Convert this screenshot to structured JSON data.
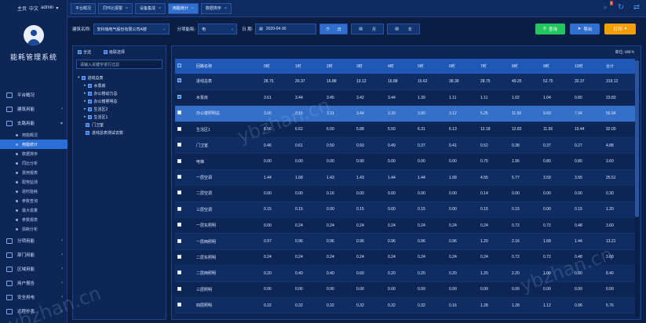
{
  "user": {
    "home": "主页",
    "lang": "中文",
    "name": "admin",
    "caret": "▾"
  },
  "system_title": "能耗管理系统",
  "menu": [
    {
      "label": "平台概况",
      "arrow": ""
    },
    {
      "label": "建筑用能",
      "arrow": "›"
    },
    {
      "label": "支路用能",
      "arrow": "▾"
    }
  ],
  "submenu": [
    "用能概况",
    "用能统计",
    "数据排序",
    "同比分析",
    "费用报表",
    "配电监测",
    "逐时能耗",
    "参数查询",
    "最大需量",
    "参数报表",
    "损耗分析"
  ],
  "menu2": [
    {
      "label": "分项用能",
      "arrow": "›"
    },
    {
      "label": "部门用能",
      "arrow": "›"
    },
    {
      "label": "区域用能",
      "arrow": "›"
    },
    {
      "label": "用户报告",
      "arrow": "›"
    },
    {
      "label": "安全用电",
      "arrow": "›"
    },
    {
      "label": "远程抄表",
      "arrow": "›"
    }
  ],
  "tabs": [
    {
      "label": "平台概况",
      "closable": false
    },
    {
      "label": "同环比报警",
      "closable": true
    },
    {
      "label": "设备集成",
      "closable": true
    },
    {
      "label": "用能统计",
      "closable": true
    },
    {
      "label": "数据排序",
      "closable": true
    }
  ],
  "header_badge": "1",
  "filters": {
    "building_label": "建筑名称:",
    "building_value": "安科瑞电气股份有限公司A楼",
    "energy_label": "分项能耗:",
    "energy_value": "电",
    "date_label": "日 期:",
    "date_value": "2020-04-30",
    "seg_day": "日",
    "seg_month": "月",
    "seg_year": "年",
    "query": "查询",
    "export": "导出",
    "print": "打印"
  },
  "tree": {
    "all_label": "全选",
    "cascade_label": "级联选择",
    "placeholder": "请输入关键字进行过滤",
    "nodes": [
      {
        "label": "进线总表",
        "level": 0,
        "toggle": "▾"
      },
      {
        "label": "水泵房",
        "level": 1,
        "toggle": "▸"
      },
      {
        "label": "办公楼动力总",
        "level": 1,
        "toggle": "▸"
      },
      {
        "label": "办公楼照明总",
        "level": 1,
        "toggle": "▸"
      },
      {
        "label": "生活区2",
        "level": 1,
        "toggle": "▸"
      },
      {
        "label": "生活区1",
        "level": 1,
        "toggle": "▸"
      },
      {
        "label": "门卫室",
        "level": 1,
        "toggle": ""
      },
      {
        "label": "进线总表测试去数",
        "level": 1,
        "toggle": ""
      }
    ]
  },
  "table": {
    "unit": "单位: kW·h",
    "columns": [
      "回路名称",
      "0时",
      "1时",
      "2时",
      "3时",
      "4时",
      "5时",
      "6时",
      "7时",
      "8时",
      "9时",
      "10时",
      "合计"
    ],
    "rows": [
      {
        "checked": true,
        "hl": false,
        "cells": [
          "进线总表",
          "28.75",
          "20.37",
          "16.88",
          "19.12",
          "16.88",
          "15.62",
          "38.38",
          "28.75",
          "49.25",
          "52.75",
          "32.37",
          "319.12"
        ]
      },
      {
        "checked": true,
        "hl": false,
        "cells": [
          "水泵房",
          "3.61",
          "3.44",
          "3.45",
          "3.42",
          "3.44",
          "1.39",
          "1.11",
          "1.11",
          "1.02",
          "1.04",
          "0.80",
          "23.83"
        ]
      },
      {
        "checked": false,
        "hl": true,
        "cells": [
          "办公楼照明总",
          "3.00",
          "3.15",
          "3.31",
          "3.44",
          "3.30",
          "3.00",
          "3.12",
          "5.25",
          "11.50",
          "9.69",
          "7.94",
          "56.94"
        ]
      },
      {
        "checked": false,
        "hl": false,
        "cells": [
          "生活区1",
          "6.56",
          "6.62",
          "6.00",
          "5.88",
          "5.50",
          "6.31",
          "6.13",
          "12.18",
          "12.82",
          "11.56",
          "10.44",
          "92.00"
        ]
      },
      {
        "checked": false,
        "hl": false,
        "cells": [
          "门卫室",
          "0.46",
          "0.61",
          "0.50",
          "0.50",
          "0.49",
          "0.37",
          "0.41",
          "0.52",
          "0.38",
          "0.37",
          "0.27",
          "4.88"
        ]
      },
      {
        "checked": false,
        "hl": false,
        "cells": [
          "电梯",
          "0.00",
          "0.00",
          "0.00",
          "0.90",
          "0.00",
          "0.00",
          "0.00",
          "0.75",
          "1.95",
          "0.80",
          "0.80",
          "3.60"
        ]
      },
      {
        "checked": false,
        "hl": false,
        "cells": [
          "一层空调",
          "1.44",
          "1.68",
          "1.43",
          "1.43",
          "1.44",
          "1.44",
          "1.68",
          "4.55",
          "5.77",
          "3.59",
          "3.55",
          "25.51"
        ]
      },
      {
        "checked": false,
        "hl": false,
        "cells": [
          "二层空调",
          "0.00",
          "0.00",
          "0.16",
          "0.00",
          "0.00",
          "0.00",
          "0.00",
          "0.14",
          "0.00",
          "0.00",
          "0.00",
          "0.30"
        ]
      },
      {
        "checked": false,
        "hl": false,
        "cells": [
          "三层空调",
          "0.15",
          "0.15",
          "0.00",
          "0.15",
          "0.00",
          "0.15",
          "0.00",
          "0.15",
          "0.15",
          "0.00",
          "0.15",
          "1.20"
        ]
      },
      {
        "checked": false,
        "hl": false,
        "cells": [
          "一层东照明",
          "0.00",
          "0.24",
          "0.24",
          "0.24",
          "0.24",
          "0.24",
          "0.24",
          "0.24",
          "0.72",
          "0.72",
          "0.48",
          "3.60"
        ]
      },
      {
        "checked": false,
        "hl": false,
        "cells": [
          "一层西照明",
          "0.97",
          "0.96",
          "0.96",
          "0.96",
          "0.96",
          "0.96",
          "0.96",
          "1.20",
          "2.16",
          "1.68",
          "1.44",
          "13.21"
        ]
      },
      {
        "checked": false,
        "hl": false,
        "cells": [
          "二层东照明",
          "0.24",
          "0.24",
          "0.24",
          "0.24",
          "0.24",
          "0.24",
          "0.24",
          "0.24",
          "0.72",
          "0.72",
          "0.48",
          "3.68"
        ]
      },
      {
        "checked": false,
        "hl": false,
        "cells": [
          "二层西照明",
          "0.20",
          "0.40",
          "0.40",
          "0.60",
          "0.20",
          "0.20",
          "0.20",
          "1.20",
          "2.20",
          "1.00",
          "0.80",
          "8.40"
        ]
      },
      {
        "checked": false,
        "hl": false,
        "cells": [
          "三层照明",
          "0.00",
          "0.00",
          "0.00",
          "0.00",
          "0.00",
          "0.00",
          "0.00",
          "0.00",
          "0.00",
          "0.00",
          "0.00",
          "0.00"
        ]
      },
      {
        "checked": false,
        "hl": false,
        "cells": [
          "四层照明",
          "0.32",
          "0.32",
          "0.32",
          "0.32",
          "0.32",
          "0.32",
          "0.16",
          "1.28",
          "1.28",
          "1.12",
          "0.96",
          "5.76"
        ]
      }
    ]
  },
  "watermarks": [
    "ybzhan.cn",
    "ybzhan.cn",
    "ybzhan.cn"
  ],
  "colors": {
    "accent": "#2f6fd0",
    "query": "#22c55e",
    "export": "#2f6fd0",
    "print": "#f59e0b"
  }
}
